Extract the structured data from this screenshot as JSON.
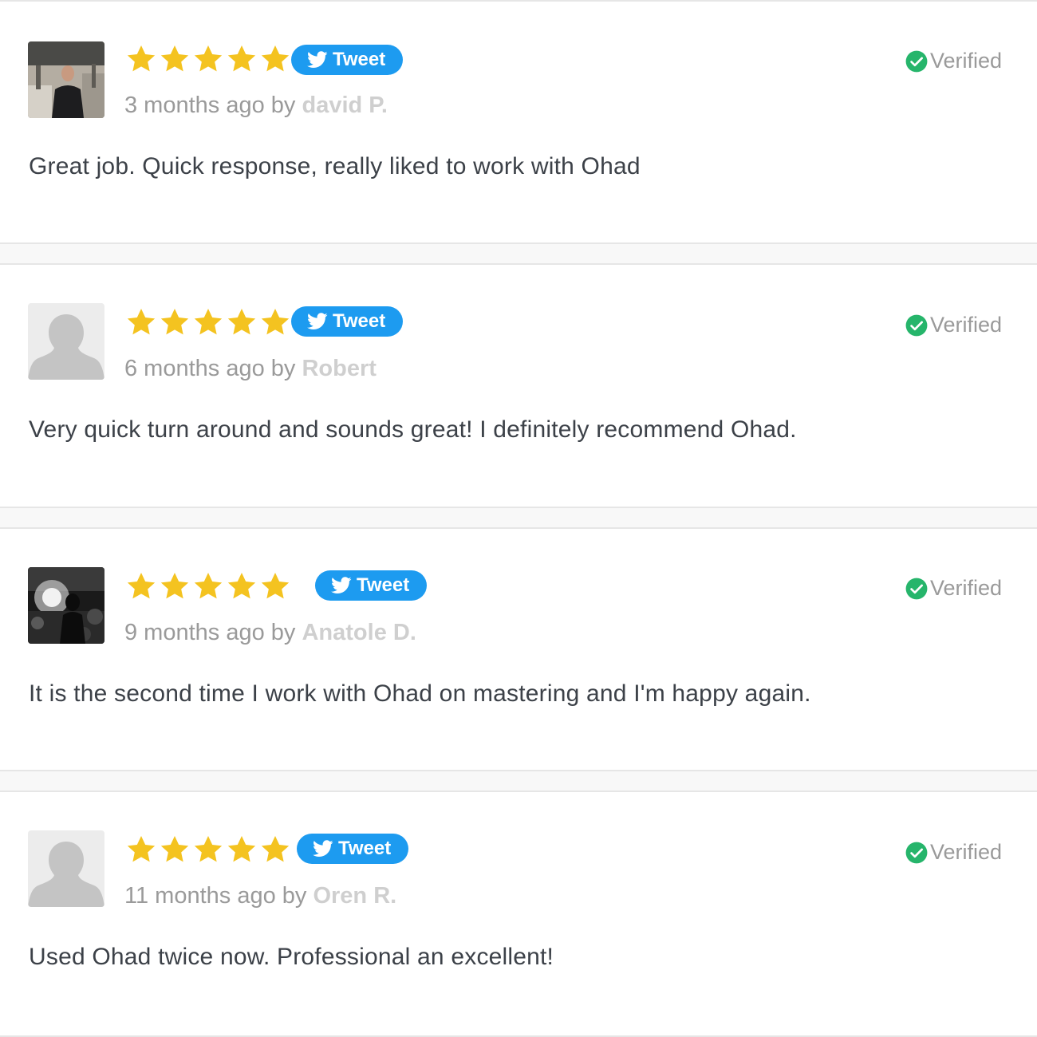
{
  "colors": {
    "star": "#f4c320",
    "tweet": "#1d9bf0",
    "verified": "#26b56b",
    "author": "#cfcfcf",
    "meta": "#9a9a9a",
    "text": "#3c4148"
  },
  "reviews": [
    {
      "rating": 5,
      "tweet_label": "Tweet",
      "time_prefix": "3 months ago by ",
      "author": "david P.",
      "verified_label": "Verified",
      "text": "Great job. Quick response, really liked to work with Ohad",
      "avatar": "photo-man-in-abandoned-building"
    },
    {
      "rating": 5,
      "tweet_label": "Tweet",
      "time_prefix": "6 months ago by ",
      "author": "Robert",
      "verified_label": "Verified",
      "text": "Very quick turn around and sounds great! I definitely recommend Ohad.",
      "avatar": "default-user-silhouette"
    },
    {
      "rating": 5,
      "tweet_label": "Tweet",
      "time_prefix": "9 months ago by ",
      "author": "Anatole D.",
      "verified_label": "Verified",
      "text": "It is the second time I work with Ohad on mastering and I'm happy again.",
      "avatar": "photo-dark-backlit-figure"
    },
    {
      "rating": 5,
      "tweet_label": "Tweet",
      "time_prefix": "11 months ago by ",
      "author": "Oren R.",
      "verified_label": "Verified",
      "text": "Used Ohad twice now. Professional an excellent!",
      "avatar": "default-user-silhouette"
    }
  ]
}
